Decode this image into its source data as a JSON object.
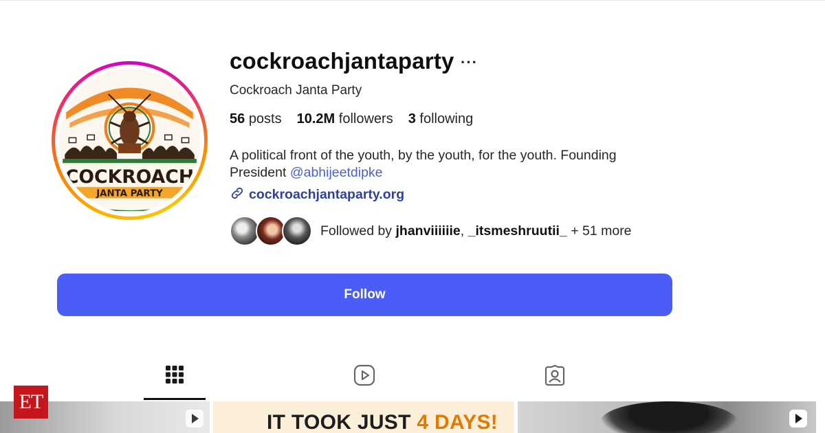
{
  "profile": {
    "username": "cockroachjantaparty",
    "full_name": "Cockroach Janta Party",
    "logo_text_main": "COCKROACH",
    "logo_text_sub": "JANTA PARTY"
  },
  "stats": {
    "posts_count": "56",
    "posts_label": "posts",
    "followers_count": "10.2M",
    "followers_label": "followers",
    "following_count": "3",
    "following_label": "following"
  },
  "bio": {
    "text": "A political front of the youth, by the youth, for the youth. Founding President",
    "mention": "@abhijeetdipke",
    "link": "cockroachjantaparty.org"
  },
  "followed_by": {
    "prefix": "Followed by",
    "user1": "jhanviiiiiie",
    "separator": ",",
    "user2": "_itsmeshruutii_",
    "suffix": "+ 51 more"
  },
  "actions": {
    "follow_label": "Follow",
    "more_label": "···"
  },
  "tabs": [
    "Posts",
    "Reels",
    "Tagged"
  ],
  "grid": {
    "tile2_text": "IT TOOK JUST",
    "tile2_highlight": "4 DAYS!"
  },
  "watermark": {
    "brand": "ET"
  },
  "colors": {
    "follow_button": "#4a5df7",
    "mention": "#4a5fd4",
    "link": "#2f3fa8",
    "et_red": "#c4161c"
  }
}
